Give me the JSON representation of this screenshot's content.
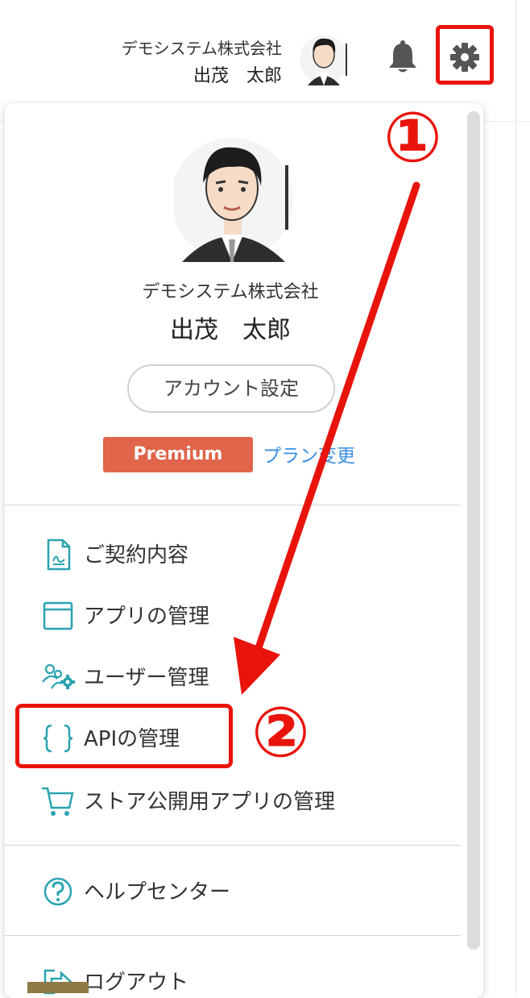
{
  "header": {
    "company": "デモシステム株式会社",
    "user_name": "出茂　太郎"
  },
  "icons": {
    "notification": "bell-icon",
    "settings": "gear-icon"
  },
  "profile": {
    "company": "デモシステム株式会社",
    "user_name": "出茂　太郎",
    "account_settings_label": "アカウント設定",
    "plan_badge": "Premium",
    "plan_change_label": "プラン変更"
  },
  "menu": {
    "items": [
      {
        "label": "ご契約内容",
        "icon": "contract-document-icon"
      },
      {
        "label": "アプリの管理",
        "icon": "app-window-icon"
      },
      {
        "label": "ユーザー管理",
        "icon": "users-gear-icon"
      },
      {
        "label": "APIの管理",
        "icon": "curly-braces-icon"
      },
      {
        "label": "ストア公開用アプリの管理",
        "icon": "cart-icon"
      },
      {
        "label": "ヘルプセンター",
        "icon": "help-circle-icon"
      },
      {
        "label": "ログアウト",
        "icon": "logout-icon"
      }
    ]
  },
  "annotations": {
    "step1": "①",
    "step2": "②"
  },
  "colors": {
    "accent_teal": "#2aa3b0",
    "premium": "#e0654a",
    "link_blue": "#3b8fe0",
    "annotation_red": "#e8140c"
  }
}
